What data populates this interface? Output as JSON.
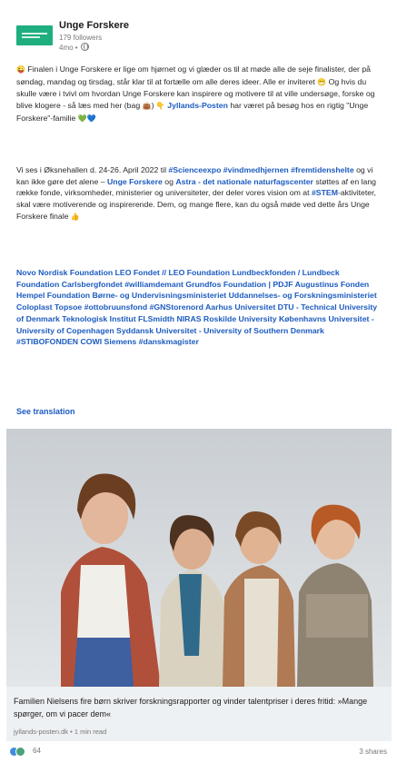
{
  "post": {
    "author": "Unge Forskere",
    "followers": "179 followers",
    "time": "4mo •",
    "visibility_icon": "globe-icon"
  },
  "body": {
    "p1_a": "Finalen i Unge Forskere er lige om hjørnet og vi glæder os til at møde alle de seje finalister, der på søndag, mandag og tirsdag, står klar til at fortælle om alle deres ideer. Alle er inviteret",
    "p1_b": "Og hvis du skulle være i tvivl om hvordan Unge Forskere kan inspirere og motivere til at ville undersøge, forske og blive klogere - så læs med her (bag",
    "p1_c": ")",
    "p1_link": "Jyllands-Posten",
    "p1_d": "har været på besøg hos en rigtig \"Unge Forskere\"-familie",
    "p2_a": "Vi ses i Øksnehallen d. 24-26. April 2022 til",
    "p2_tags1": "#Scienceexpo #vindmedhjernen #fremtidenshelte",
    "p2_b": "og vi kan ikke gøre det alene –",
    "p2_link1": "Unge Forskere",
    "p2_og": "og",
    "p2_link2": "Astra - det nationale naturfagscenter",
    "p2_c": "støttes af en lang række fonde, virksomheder, ministerier og universiteter, der deler vores vision om at",
    "p2_tag2": "#STEM",
    "p2_d": "-aktiviteter, skal være motiverende og inspirerende. Dem, og mange flere, kan du også møde ved dette års Unge Forskere finale",
    "p3": "Novo Nordisk Foundation LEO Fondet // LEO Foundation Lundbeckfonden / Lundbeck Foundation Carlsbergfondet #williamdemant Grundfos Foundation | PDJF Augustinus Fonden Hempel Foundation Børne- og Undervisningsministeriet Uddannelses- og Forskningsministeriet Coloplast Topsoe #ottobruunsfond #GNStorenord Aarhus Universitet DTU - Technical University of Denmark Teknologisk Institut FLSmidth NIRAS Roskilde University Københavns Universitet - University of Copenhagen Syddansk Universitet - University of Southern Denmark #STIBOFONDEN COWI Siemens #danskmagister",
    "see_translation": "See translation"
  },
  "emoji": {
    "face": "😜",
    "grin": "😁",
    "bag": "👜",
    "point": "👇",
    "hearts": "💚💙",
    "thumb": "👍"
  },
  "article": {
    "title": "Familien Nielsens fire børn skriver forskningsrapporter og vinder talentpriser i deres fritid: »Mange spørger, om vi pacer dem«",
    "source": "jyllands-posten.dk • 1 min read"
  },
  "social": {
    "reaction_count": "64",
    "shares": "3 shares",
    "reaction_icons": [
      "like-icon",
      "celebrate-icon"
    ]
  },
  "colors": {
    "brand": "#1fae7f",
    "link": "#1c5bc0",
    "caption_bg": "#eef1f3"
  }
}
